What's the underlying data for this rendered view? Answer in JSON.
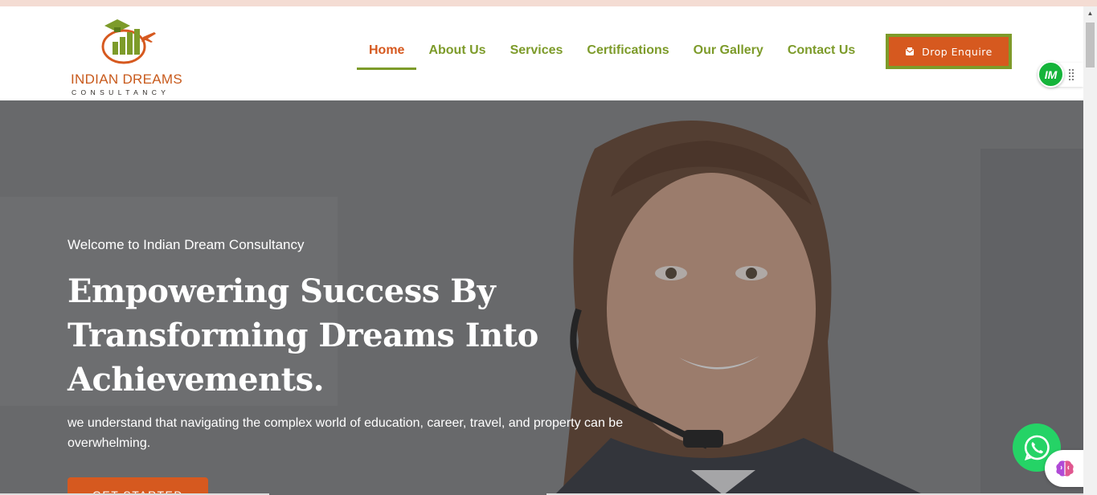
{
  "brand": {
    "name_line1": "INDIAN DREAMS",
    "name_line2": "CONSULTANCY",
    "logo_icon": "graduation-cap-bar-chart-plane-logo"
  },
  "nav": {
    "items": [
      {
        "label": "Home",
        "active": true
      },
      {
        "label": "About Us",
        "active": false
      },
      {
        "label": "Services",
        "active": false
      },
      {
        "label": "Certifications",
        "active": false
      },
      {
        "label": "Our Gallery",
        "active": false
      },
      {
        "label": "Contact Us",
        "active": false
      }
    ],
    "enquire_label": "Drop Enquire",
    "enquire_icon": "envelope-icon"
  },
  "badge": {
    "label": "IM"
  },
  "hero": {
    "welcome": "Welcome to Indian Dream Consultancy",
    "headline_line1": "Empowering Success By",
    "headline_line2": "Transforming Dreams Into",
    "headline_line3": "Achievements.",
    "subtext": "we understand that navigating the complex world of education, career, travel, and property can be overwhelming.",
    "cta_label": "GET STARTED"
  },
  "floating": {
    "whatsapp_icon": "whatsapp-icon",
    "assistant_icon": "brain-icon"
  },
  "colors": {
    "accent_orange": "#d6591f",
    "accent_green": "#7d9b2a",
    "whatsapp_green": "#25d366"
  }
}
